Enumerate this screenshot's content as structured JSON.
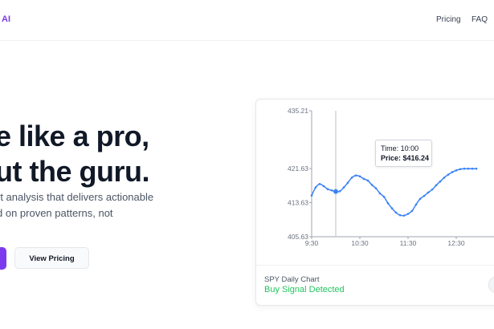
{
  "header": {
    "logo": "AI",
    "nav": [
      {
        "label": "Pricing"
      },
      {
        "label": "FAQ"
      }
    ]
  },
  "hero": {
    "headline_lines": [
      "e like a pro,",
      "ut the guru."
    ],
    "subtext_lines": [
      "rt analysis that delivers actionable",
      "d on proven patterns, not"
    ],
    "primary_button_label": "",
    "secondary_button_label": "View Pricing"
  },
  "card": {
    "title": "SPY Daily Chart",
    "status": "Buy Signal Detected",
    "colors": {
      "status": "#22c55e",
      "line": "#3b82f6",
      "accent": "#7c3aed"
    },
    "tooltip": {
      "time": "Time: 10:00",
      "price": "Price: $416.24"
    }
  },
  "chart_data": {
    "type": "line",
    "x": [
      "9:30",
      "9:35",
      "9:40",
      "9:45",
      "9:50",
      "9:55",
      "10:00",
      "10:05",
      "10:10",
      "10:15",
      "10:20",
      "10:25",
      "10:30",
      "10:35",
      "10:40",
      "10:45",
      "10:50",
      "10:55",
      "11:00",
      "11:05",
      "11:10",
      "11:15",
      "11:20",
      "11:25",
      "11:30",
      "11:35",
      "11:40",
      "11:45",
      "11:50",
      "11:55",
      "12:00",
      "12:05",
      "12:10",
      "12:15",
      "12:20",
      "12:25",
      "12:30",
      "12:35",
      "12:40",
      "12:45",
      "12:50",
      "12:55"
    ],
    "values": [
      415.3,
      417.2,
      418.0,
      417.5,
      416.8,
      416.5,
      416.24,
      416.3,
      417.2,
      418.3,
      419.5,
      420.0,
      419.8,
      419.2,
      418.8,
      417.8,
      417.0,
      415.8,
      415.0,
      413.5,
      412.3,
      411.3,
      410.7,
      410.6,
      411.0,
      411.7,
      413.2,
      414.5,
      415.2,
      416.0,
      416.7,
      417.7,
      418.6,
      419.5,
      420.2,
      420.8,
      421.2,
      421.5,
      421.6,
      421.6,
      421.6,
      421.6
    ],
    "xticks": [
      "9:30",
      "10:30",
      "11:30",
      "12:30"
    ],
    "yticks": [
      "435.21",
      "421.63",
      "413.63",
      "405.63"
    ],
    "ylim": [
      405.63,
      435.21
    ],
    "highlight": {
      "x": "10:00",
      "y": 416.24
    }
  }
}
